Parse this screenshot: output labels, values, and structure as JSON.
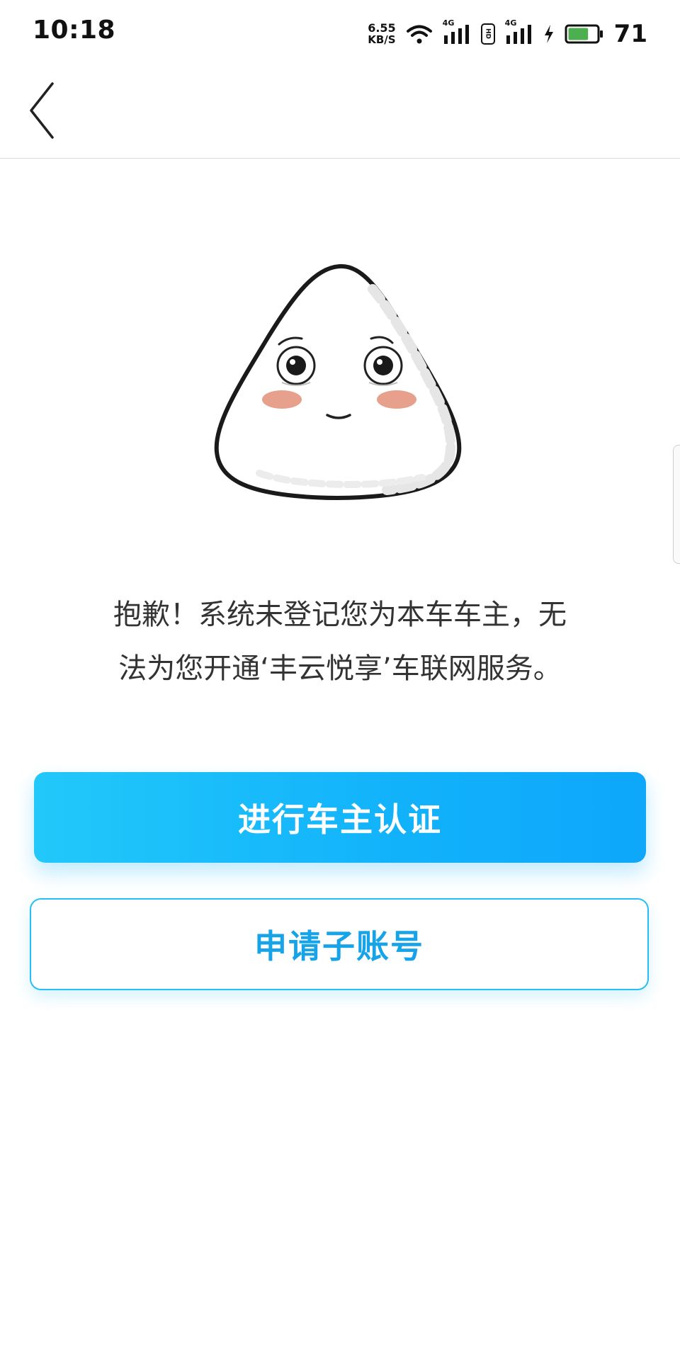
{
  "status_bar": {
    "time": "10:18",
    "net_speed_value": "6.55",
    "net_speed_unit": "KB/S",
    "signal1_tag": "4G",
    "hd_label": "HD",
    "signal2_tag": "4G",
    "battery": "71",
    "battery_level": 0.71,
    "battery_color": "#4caf50"
  },
  "nav": {
    "back_icon": "chevron-left-icon"
  },
  "mascot": {
    "icon": "rice-ball-mascot-icon"
  },
  "message": {
    "line1": "抱歉！系统未登记您为本车车主，无",
    "line2": "法为您开通‘丰云悦享’车联网服务。"
  },
  "actions": {
    "primary_label": "进行车主认证",
    "secondary_label": "申请子账号"
  },
  "colors": {
    "accent": "#12b2fb",
    "accent_light": "#22c8fa",
    "outline": "#25bff4",
    "text": "#333333"
  }
}
